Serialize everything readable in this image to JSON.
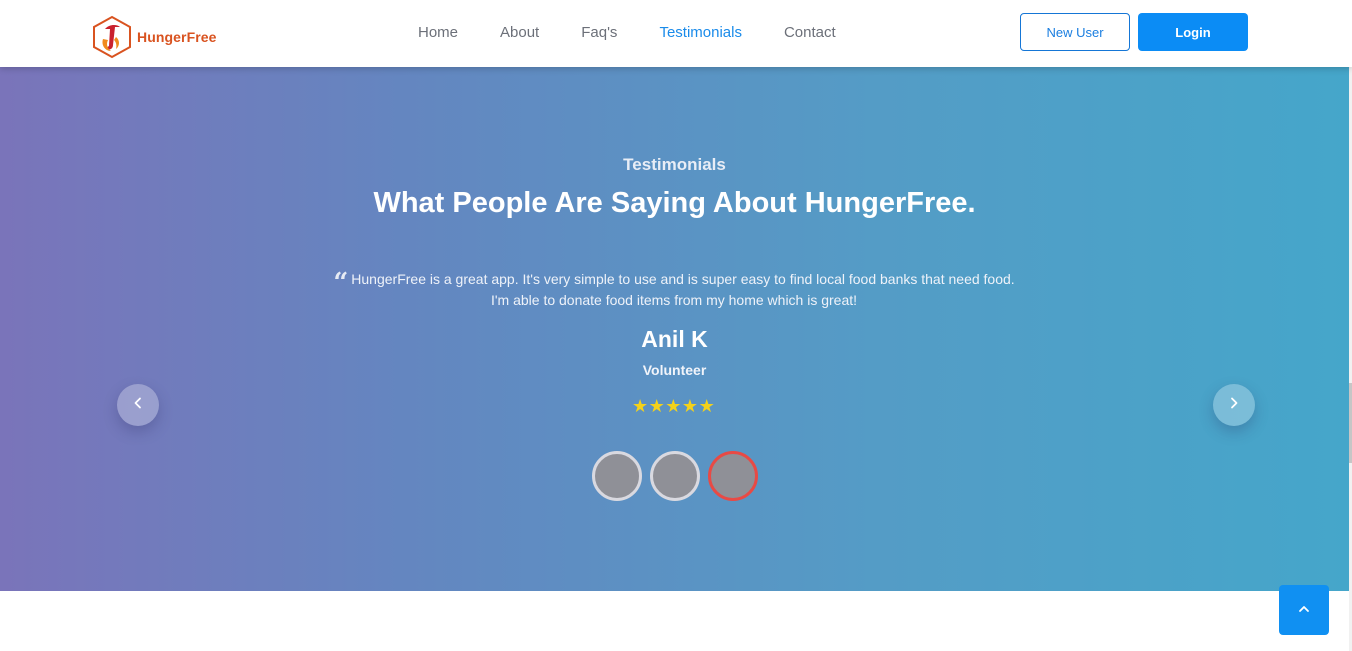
{
  "header": {
    "brand": "HungerFree",
    "nav": [
      {
        "label": "Home",
        "active": false
      },
      {
        "label": "About",
        "active": false
      },
      {
        "label": "Faq's",
        "active": false
      },
      {
        "label": "Testimonials",
        "active": true
      },
      {
        "label": "Contact",
        "active": false
      }
    ],
    "new_user_label": "New User",
    "login_label": "Login"
  },
  "testimonials": {
    "eyebrow": "Testimonials",
    "heading": "What People Are Saying About HungerFree.",
    "quote": "HungerFree is a great app. It's very simple to use and is super easy to find local food banks that need food. I'm able to donate food items from my home which is great!",
    "author": "Anil K",
    "role": "Volunteer",
    "rating": 5,
    "rating_max": 5,
    "active_dot_index": 2,
    "dot_count": 3
  },
  "icons": {
    "quote": "quote-icon",
    "prev": "chevron-left-icon",
    "next": "chevron-right-icon",
    "to_top": "chevron-up-icon",
    "star": "star-icon"
  },
  "colors": {
    "brand": "#d95320",
    "accent": "#0b8cf5",
    "nav_active": "#1a8bea",
    "star": "#f4d21a",
    "active_dot_border": "#e84a45",
    "hero_gradient_start": "#7a74ba",
    "hero_gradient_end": "#45a6ca"
  }
}
